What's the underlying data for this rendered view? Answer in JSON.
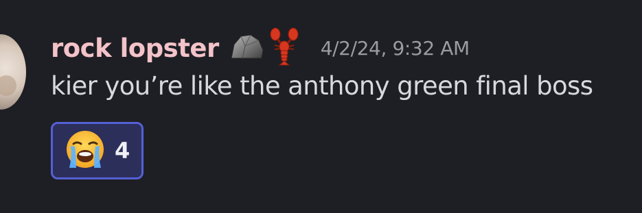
{
  "message": {
    "author": "rock lopster",
    "author_color": "#f3c3c9",
    "badges": [
      "rock-emoji",
      "lobster-emoji"
    ],
    "timestamp": "4/2/24, 9:32 AM",
    "content": "kier you’re like the anthony green final boss"
  },
  "reactions": [
    {
      "emoji": "loudly-crying-face-emoji",
      "count": "4"
    }
  ],
  "colors": {
    "background": "#1e1f24",
    "reaction_border": "#5560d6",
    "reaction_bg": "#2c2f5a"
  }
}
